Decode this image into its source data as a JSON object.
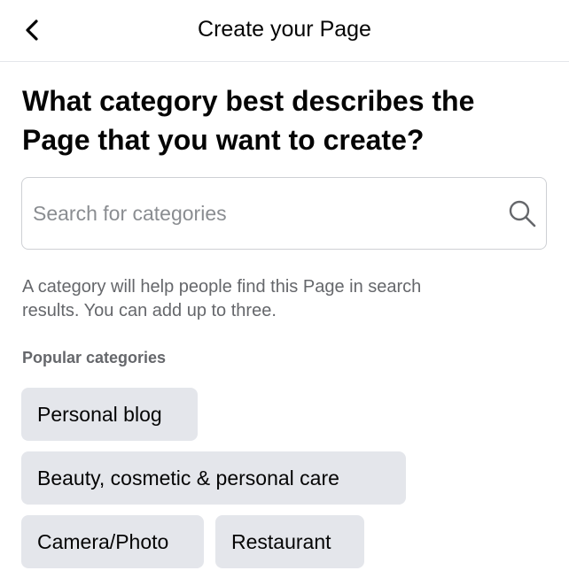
{
  "header": {
    "title": "Create your Page",
    "back_icon": "chevron-left-icon"
  },
  "main": {
    "heading_line1": "What category best describes the",
    "heading_line2": "Page that you want to create?",
    "search": {
      "placeholder": "Search for categories",
      "value": "",
      "icon": "search-icon"
    },
    "helper_line1": "A category will help people find this Page in search",
    "helper_line2": "results. You can add up to three.",
    "popular_label": "Popular categories",
    "categories": [
      {
        "label": "Personal blog"
      },
      {
        "label": "Beauty, cosmetic & personal care"
      },
      {
        "label": "Camera/Photo"
      },
      {
        "label": "Restaurant"
      }
    ]
  },
  "colors": {
    "chip_background": "#e4e6eb",
    "text_primary": "#050505",
    "text_secondary": "#65676b",
    "input_border": "#ced0d4"
  }
}
